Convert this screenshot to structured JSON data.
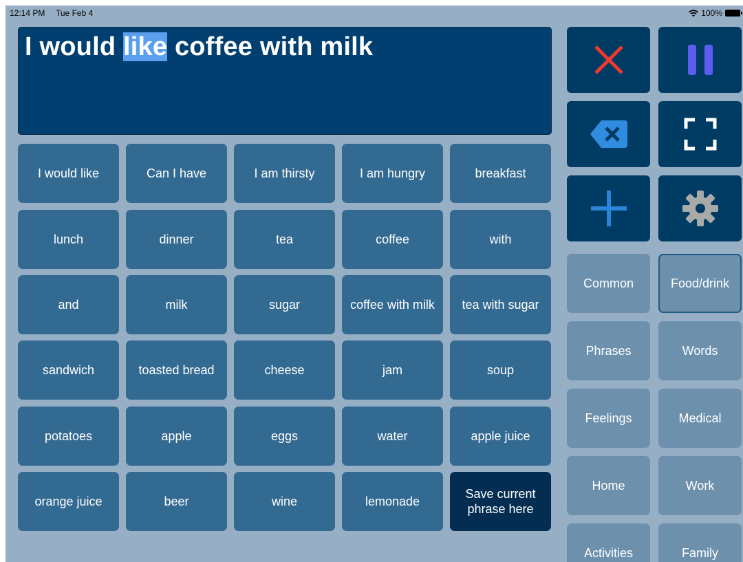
{
  "status_bar": {
    "time": "12:14 PM",
    "date": "Tue Feb 4",
    "battery": "100%"
  },
  "phrase": {
    "before": "I would ",
    "highlighted": "like",
    "after": " coffee with milk"
  },
  "tiles": [
    "I would like",
    "Can I have",
    "I am thirsty",
    "I am hungry",
    "breakfast",
    "lunch",
    "dinner",
    "tea",
    "coffee",
    "with",
    "and",
    "milk",
    "sugar",
    "coffee with milk",
    "tea with sugar",
    "sandwich",
    "toasted bread",
    "cheese",
    "jam",
    "soup",
    "potatoes",
    "apple",
    "eggs",
    "water",
    "apple juice",
    "orange juice",
    "beer",
    "wine",
    "lemonade"
  ],
  "save_tile": {
    "line1": "Save current",
    "line2": "phrase here"
  },
  "controls": [
    {
      "icon": "close-icon",
      "color": "#f2392f"
    },
    {
      "icon": "pause-icon",
      "color": "#5b5cf0"
    },
    {
      "icon": "backspace-icon",
      "color": "#2f8ce0"
    },
    {
      "icon": "fullscreen-icon",
      "color": "#ffffff"
    },
    {
      "icon": "plus-icon",
      "color": "#2a86d8"
    },
    {
      "icon": "gear-icon",
      "color": "#a9a9a9"
    }
  ],
  "categories": [
    {
      "label": "Common",
      "selected": false
    },
    {
      "label": "Food/drink",
      "selected": true
    },
    {
      "label": "Phrases",
      "selected": false
    },
    {
      "label": "Words",
      "selected": false
    },
    {
      "label": "Feelings",
      "selected": false
    },
    {
      "label": "Medical",
      "selected": false
    },
    {
      "label": "Home",
      "selected": false
    },
    {
      "label": "Work",
      "selected": false
    },
    {
      "label": "Activities",
      "selected": false
    },
    {
      "label": "Family",
      "selected": false
    }
  ]
}
